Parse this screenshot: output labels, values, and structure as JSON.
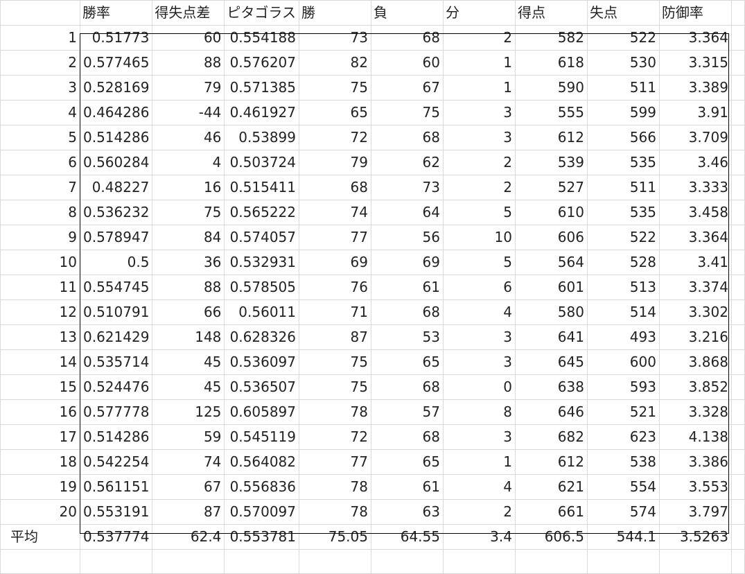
{
  "headers": [
    "勝率",
    "得失点差",
    "ピタゴラス",
    "勝",
    "負",
    "分",
    "得点",
    "失点",
    "防御率"
  ],
  "rows": [
    {
      "id": "1",
      "values": [
        "0.51773",
        "60",
        "0.554188",
        "73",
        "68",
        "2",
        "582",
        "522",
        "3.364"
      ]
    },
    {
      "id": "2",
      "values": [
        "0.577465",
        "88",
        "0.576207",
        "82",
        "60",
        "1",
        "618",
        "530",
        "3.315"
      ]
    },
    {
      "id": "3",
      "values": [
        "0.528169",
        "79",
        "0.571385",
        "75",
        "67",
        "1",
        "590",
        "511",
        "3.389"
      ]
    },
    {
      "id": "4",
      "values": [
        "0.464286",
        "-44",
        "0.461927",
        "65",
        "75",
        "3",
        "555",
        "599",
        "3.91"
      ]
    },
    {
      "id": "5",
      "values": [
        "0.514286",
        "46",
        "0.53899",
        "72",
        "68",
        "3",
        "612",
        "566",
        "3.709"
      ]
    },
    {
      "id": "6",
      "values": [
        "0.560284",
        "4",
        "0.503724",
        "79",
        "62",
        "2",
        "539",
        "535",
        "3.46"
      ]
    },
    {
      "id": "7",
      "values": [
        "0.48227",
        "16",
        "0.515411",
        "68",
        "73",
        "2",
        "527",
        "511",
        "3.333"
      ]
    },
    {
      "id": "8",
      "values": [
        "0.536232",
        "75",
        "0.565222",
        "74",
        "64",
        "5",
        "610",
        "535",
        "3.458"
      ]
    },
    {
      "id": "9",
      "values": [
        "0.578947",
        "84",
        "0.574057",
        "77",
        "56",
        "10",
        "606",
        "522",
        "3.364"
      ]
    },
    {
      "id": "10",
      "values": [
        "0.5",
        "36",
        "0.532931",
        "69",
        "69",
        "5",
        "564",
        "528",
        "3.41"
      ]
    },
    {
      "id": "11",
      "values": [
        "0.554745",
        "88",
        "0.578505",
        "76",
        "61",
        "6",
        "601",
        "513",
        "3.374"
      ]
    },
    {
      "id": "12",
      "values": [
        "0.510791",
        "66",
        "0.56011",
        "71",
        "68",
        "4",
        "580",
        "514",
        "3.302"
      ]
    },
    {
      "id": "13",
      "values": [
        "0.621429",
        "148",
        "0.628326",
        "87",
        "53",
        "3",
        "641",
        "493",
        "3.216"
      ]
    },
    {
      "id": "14",
      "values": [
        "0.535714",
        "45",
        "0.536097",
        "75",
        "65",
        "3",
        "645",
        "600",
        "3.868"
      ]
    },
    {
      "id": "15",
      "values": [
        "0.524476",
        "45",
        "0.536507",
        "75",
        "68",
        "0",
        "638",
        "593",
        "3.852"
      ]
    },
    {
      "id": "16",
      "values": [
        "0.577778",
        "125",
        "0.605897",
        "78",
        "57",
        "8",
        "646",
        "521",
        "3.328"
      ]
    },
    {
      "id": "17",
      "values": [
        "0.514286",
        "59",
        "0.545119",
        "72",
        "68",
        "3",
        "682",
        "623",
        "4.138"
      ]
    },
    {
      "id": "18",
      "values": [
        "0.542254",
        "74",
        "0.564082",
        "77",
        "65",
        "1",
        "612",
        "538",
        "3.386"
      ]
    },
    {
      "id": "19",
      "values": [
        "0.561151",
        "67",
        "0.556836",
        "78",
        "61",
        "4",
        "621",
        "554",
        "3.553"
      ]
    },
    {
      "id": "20",
      "values": [
        "0.553191",
        "87",
        "0.570097",
        "78",
        "63",
        "2",
        "661",
        "574",
        "3.797"
      ]
    }
  ],
  "average": {
    "label": "平均",
    "values": [
      "0.537774",
      "62.4",
      "0.553781",
      "75.05",
      "64.55",
      "3.4",
      "606.5",
      "544.1",
      "3.5263"
    ]
  }
}
